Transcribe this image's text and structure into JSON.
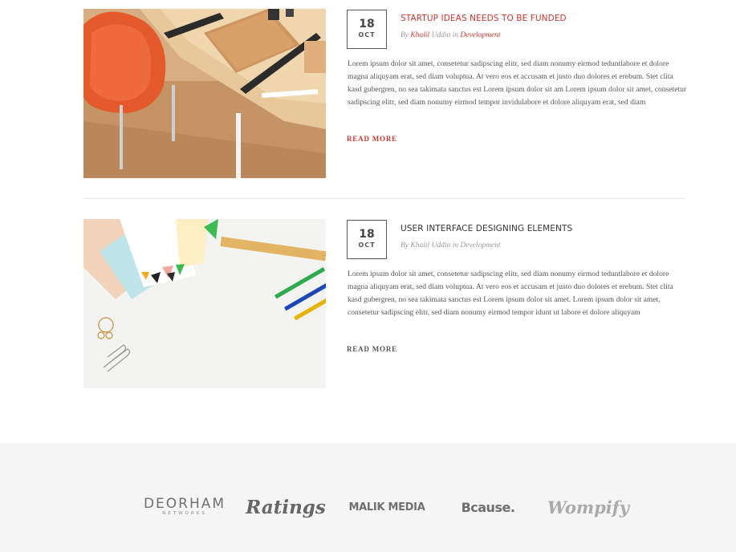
{
  "posts": [
    {
      "day": "18",
      "month": "OCT",
      "title": "STARTUP IDEAS NEEDS TO BE FUNDED",
      "by": "By",
      "author_first": "Khalil",
      "author_last": "Uddin",
      "in": "in",
      "category": "Development",
      "excerpt": "Lorem ipsum dolor sit amet, consetetur sadipscing elitr, sed diam nonumy eirmod teduntlabore et dolore magna aliquyam erat, sed diam voluptua. At vero eos et accusam et justo duo dolores et erebum. Stet clita kasd gubergren, no sea takimata sanctus est Lorem ipsum dolor sit am Lorem ipsum dolor sit amet, consetetur sadipscing elitr, sed diam nonumy eirmod tempor invidulabore et dolore aliquyam erat, sed diam",
      "read_more": "READ MORE",
      "image_icon": "desk-workspace-photo"
    },
    {
      "day": "18",
      "month": "OCT",
      "title": "USER INTERFACE DESIGNING ELEMENTS",
      "by": "By Khalil Uddin in Development",
      "excerpt": "Lorem ipsum dolor sit amet, consetetur sadipscing elitr, sed diam nonumy eirmod teduntlabore et dolore magna aliquyam erat, sed diam voluptua. At vero eos et accusam et justo duo dolores et erebum. Stet clita kasd gubergren, no sea takimata sanctus est Lorem ipsum dolor sit amet. Lorem ipsum dolor sit amet, consetetur sadipscing elitr, sed diam nonumy eirmod tempor idunt ut labore et dolore aliquyam",
      "read_more": "READ MORE",
      "image_icon": "stationery-flatlay-photo"
    }
  ],
  "logos": {
    "deorham_main": "DEORHAM",
    "deorham_sub": "NETWORKS",
    "ratings": "Ratings",
    "malik": "MALIK MEDIA",
    "bcause": "Bcause.",
    "wompify": "Wompify"
  },
  "colors": {
    "accent": "#c8372d",
    "text": "#555555",
    "logo_band": "#f5f5f5"
  }
}
